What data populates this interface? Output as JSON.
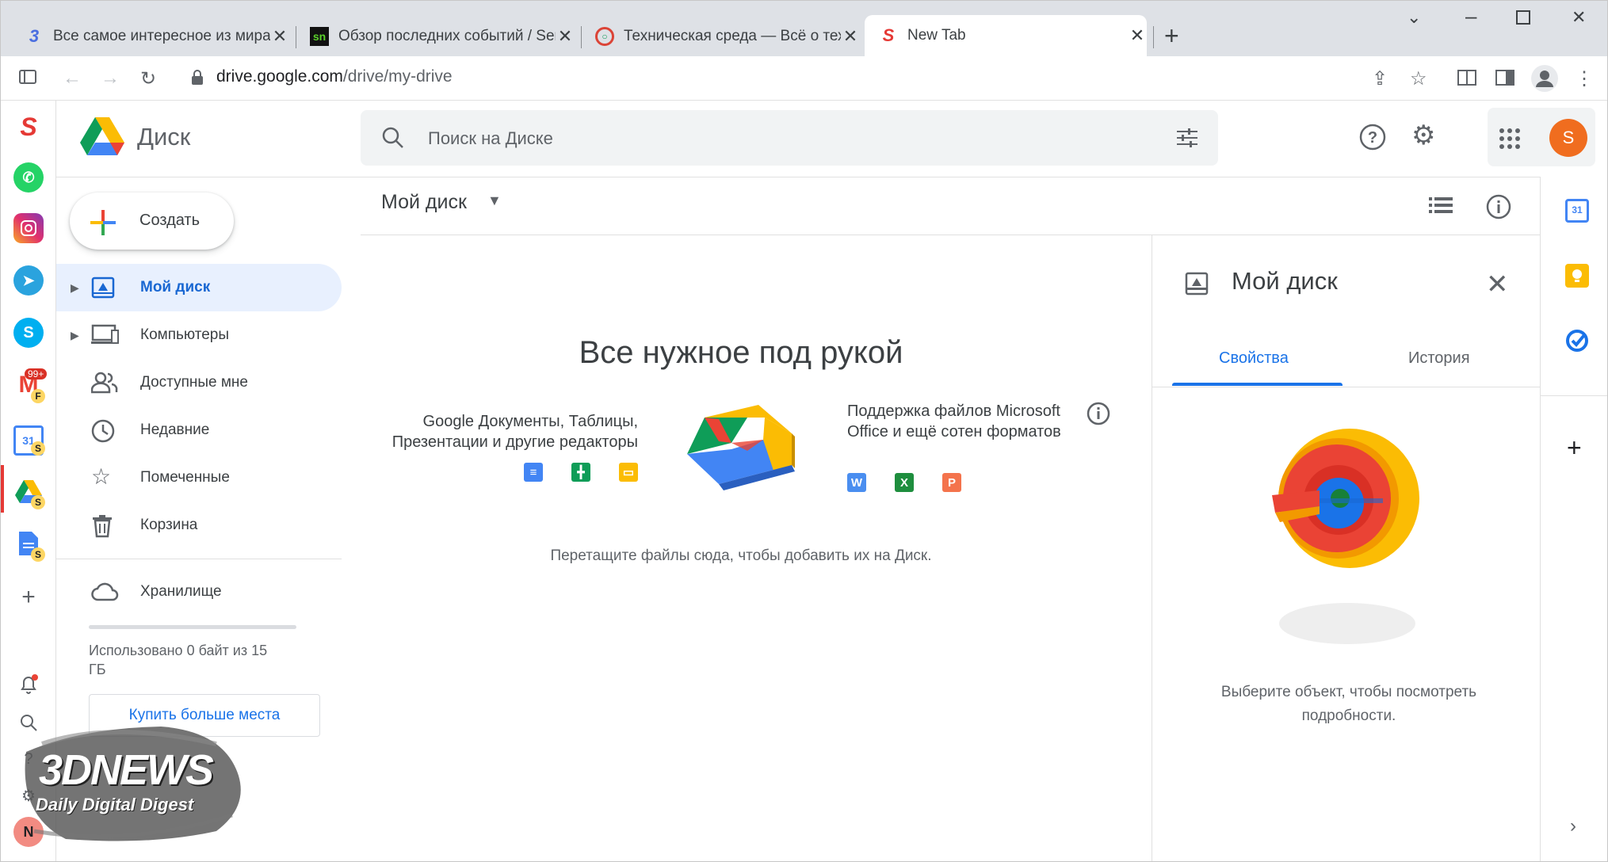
{
  "browser": {
    "tabs": [
      {
        "title": "Все самое интересное из мира",
        "favicon": "3"
      },
      {
        "title": "Обзор последних событий / Ser",
        "favicon": "sn"
      },
      {
        "title": "Техническая среда — Всё о техн",
        "favicon": "○"
      },
      {
        "title": "New Tab",
        "favicon": "S"
      }
    ],
    "url_host": "drive.google.com",
    "url_path": "/drive/my-drive",
    "sidebar_badges": {
      "gmail_count": "99+",
      "gmail_tag": "F",
      "s_tag": "S"
    },
    "sidebar_avatar": "N"
  },
  "drive": {
    "logo_text": "Диск",
    "search_placeholder": "Поиск на Диске",
    "avatar_letter": "S",
    "create_label": "Создать",
    "nav": [
      {
        "label": "Мой диск",
        "active": true
      },
      {
        "label": "Компьютеры"
      },
      {
        "label": "Доступные мне"
      },
      {
        "label": "Недавние"
      },
      {
        "label": "Помеченные"
      },
      {
        "label": "Корзина"
      }
    ],
    "storage_label": "Хранилище",
    "storage_used": "Использовано 0 байт из 15 ГБ",
    "storage_fraction": 0,
    "buy_label": "Купить больше места",
    "breadcrumb": "Мой диск",
    "empty_title": "Все нужное под рукой",
    "feature_left": "Google Документы, Таблицы, Презентации и другие редакторы",
    "feature_right": "Поддержка файлов Microsoft Office и ещё сотен форматов",
    "office_letters": [
      "W",
      "X",
      "P"
    ],
    "drop_hint": "Перетащите файлы сюда, чтобы добавить их на Диск.",
    "details": {
      "title": "Мой диск",
      "tab_properties": "Свойства",
      "tab_history": "История",
      "message": "Выберите объект, чтобы посмотреть подробности."
    },
    "calendar_day": "31"
  },
  "watermark": {
    "brand": "3DNEWS",
    "tagline": "Daily Digital Digest"
  },
  "colors": {
    "accent": "#1a73e8",
    "active_bg": "#e8f0fe",
    "avatar": "#f06d1f"
  }
}
